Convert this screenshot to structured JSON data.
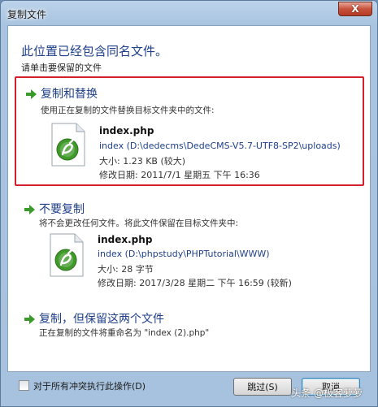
{
  "window": {
    "title": "复制文件",
    "close_label": "X"
  },
  "dialog": {
    "heading": "此位置已经包含同名文件。",
    "subheading": "请单击要保留的文件"
  },
  "options": [
    {
      "title": "复制和替换",
      "description": "使用正在复制的文件替换目标文件夹中的文件:",
      "file": {
        "name": "index.php",
        "path": "index (D:\\dedecms\\DedeCMS-V5.7-UTF8-SP2\\uploads)",
        "size": "大小: 1.23 KB (较大)",
        "modified": "修改日期: 2011/7/1 星期五 下午 16:36"
      }
    },
    {
      "title": "不要复制",
      "description": "将不会更改任何文件。将此文件保留在目标文件夹中:",
      "file": {
        "name": "index.php",
        "path": "index (D:\\phpstudy\\PHPTutorial\\WWW)",
        "size": "大小: 28 字节",
        "modified": "修改日期: 2017/3/28 星期二 下午 16:59 (较新)"
      }
    },
    {
      "title": "复制，但保留这两个文件",
      "description": "正在复制的文件将重命名为 \"index (2).php\""
    }
  ],
  "footer": {
    "checkbox_label": "对于所有冲突执行此操作(D)",
    "skip_label": "跳过(S)",
    "cancel_label": "取消"
  },
  "watermark": "头条 @极客萝萝",
  "colors": {
    "accent_text": "#1e3f8a",
    "highlight_border": "#d4202a",
    "arrow_green": "#3a9a2a"
  }
}
